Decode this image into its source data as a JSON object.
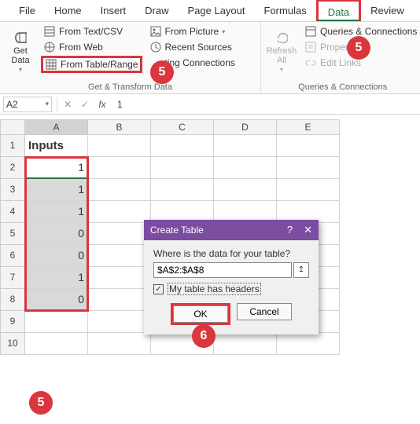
{
  "tabs": {
    "file": "File",
    "home": "Home",
    "insert": "Insert",
    "draw": "Draw",
    "page_layout": "Page Layout",
    "formulas": "Formulas",
    "data": "Data",
    "review": "Review"
  },
  "ribbon": {
    "get_data": "Get\nData",
    "from_text_csv": "From Text/CSV",
    "from_web": "From Web",
    "from_table_range": "From Table/Range",
    "from_picture": "From Picture",
    "recent_sources": "Recent Sources",
    "existing_connections": "Existing Connections",
    "group1_label": "Get & Transform Data",
    "refresh_all": "Refresh\nAll",
    "queries_connections": "Queries & Connections",
    "properties": "Properties",
    "edit_links": "Edit Links",
    "group2_label": "Queries & Connections"
  },
  "formula_bar": {
    "namebox": "A2",
    "value": "1"
  },
  "columns": [
    "A",
    "B",
    "C",
    "D",
    "E"
  ],
  "row_numbers": [
    "1",
    "2",
    "3",
    "4",
    "5",
    "6",
    "7",
    "8",
    "9",
    "10"
  ],
  "sheet": {
    "header": "Inputs",
    "values": [
      "1",
      "1",
      "1",
      "0",
      "0",
      "1",
      "0"
    ]
  },
  "dialog": {
    "title": "Create Table",
    "help": "?",
    "close": "✕",
    "prompt": "Where is the data for your table?",
    "range": "$A$2:$A$8",
    "collapse": "↥",
    "checkbox_label": "My table has headers",
    "checkbox_mark": "✓",
    "ok": "OK",
    "cancel": "Cancel"
  },
  "badges": {
    "five": "5",
    "six": "6"
  }
}
